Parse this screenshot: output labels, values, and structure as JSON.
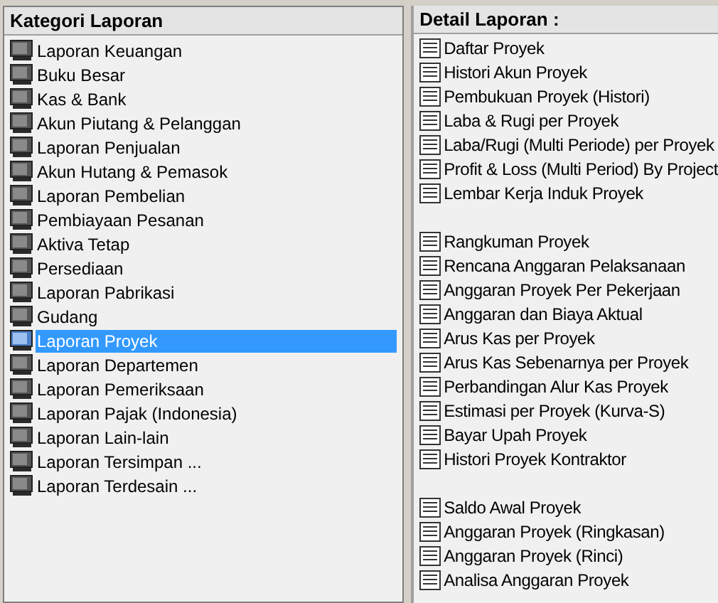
{
  "categories_panel": {
    "title": "Kategori Laporan",
    "items": [
      {
        "label": "Laporan Keuangan",
        "selected": false
      },
      {
        "label": "Buku Besar",
        "selected": false
      },
      {
        "label": "Kas & Bank",
        "selected": false
      },
      {
        "label": "Akun Piutang & Pelanggan",
        "selected": false
      },
      {
        "label": "Laporan Penjualan",
        "selected": false
      },
      {
        "label": "Akun Hutang & Pemasok",
        "selected": false
      },
      {
        "label": "Laporan Pembelian",
        "selected": false
      },
      {
        "label": "Pembiayaan Pesanan",
        "selected": false
      },
      {
        "label": "Aktiva Tetap",
        "selected": false
      },
      {
        "label": "Persediaan",
        "selected": false
      },
      {
        "label": "Laporan Pabrikasi",
        "selected": false
      },
      {
        "label": "Gudang",
        "selected": false
      },
      {
        "label": "Laporan Proyek",
        "selected": true
      },
      {
        "label": "Laporan Departemen",
        "selected": false
      },
      {
        "label": "Laporan Pemeriksaan",
        "selected": false
      },
      {
        "label": "Laporan Pajak (Indonesia)",
        "selected": false
      },
      {
        "label": "Laporan Lain-lain",
        "selected": false
      },
      {
        "label": "Laporan Tersimpan ...",
        "selected": false
      },
      {
        "label": "Laporan Terdesain ...",
        "selected": false
      }
    ]
  },
  "detail_panel": {
    "title": "Detail Laporan :",
    "groups": [
      [
        "Daftar Proyek",
        "Histori Akun Proyek",
        "Pembukuan Proyek (Histori)",
        "Laba & Rugi per Proyek",
        "Laba/Rugi (Multi Periode) per Proyek",
        "Profit & Loss (Multi Period) By Project",
        "Lembar Kerja Induk Proyek"
      ],
      [
        "Rangkuman Proyek",
        "Rencana Anggaran Pelaksanaan",
        "Anggaran Proyek Per Pekerjaan",
        "Anggaran dan Biaya Aktual",
        "Arus Kas per Proyek",
        "Arus Kas Sebenarnya per Proyek",
        "Perbandingan Alur Kas Proyek",
        "Estimasi per Proyek (Kurva-S)",
        "Bayar Upah Proyek",
        "Histori Proyek Kontraktor"
      ],
      [
        "Saldo Awal Proyek",
        "Anggaran Proyek (Ringkasan)",
        "Anggaran Proyek (Rinci)",
        "Analisa Anggaran Proyek"
      ]
    ]
  }
}
